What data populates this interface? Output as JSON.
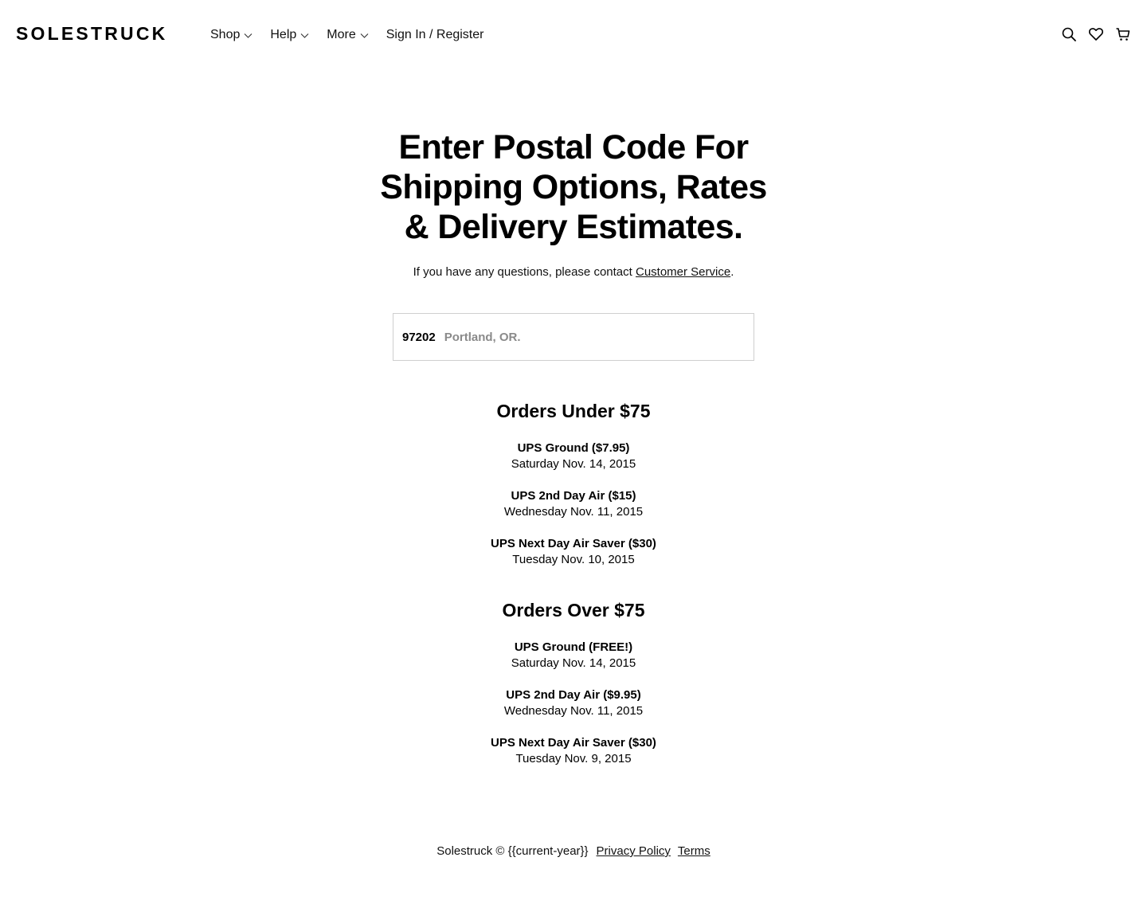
{
  "header": {
    "logo": "SOLESTRUCK",
    "nav": {
      "shop": "Shop",
      "help": "Help",
      "more": "More",
      "signin": "Sign In / Register"
    },
    "icons": [
      "search-icon",
      "heart-icon",
      "cart-icon"
    ]
  },
  "main": {
    "title_line1": "Enter Postal Code For",
    "title_line2": "Shipping Options, Rates",
    "title_line3": "& Delivery Estimates.",
    "subtitle_prefix": "If you have any questions, please contact ",
    "subtitle_link": "Customer Service",
    "subtitle_suffix": ".",
    "postal_code": "97202",
    "postal_city": "Portland, OR.",
    "under": {
      "title": "Orders Under $75",
      "options": [
        {
          "name": "UPS Ground ($7.95)",
          "date": "Saturday Nov. 14, 2015"
        },
        {
          "name": "UPS 2nd Day Air ($15)",
          "date": "Wednesday Nov. 11, 2015"
        },
        {
          "name": "UPS Next Day Air Saver ($30)",
          "date": "Tuesday Nov. 10, 2015"
        }
      ]
    },
    "over": {
      "title": "Orders Over $75",
      "options": [
        {
          "name": "UPS Ground (FREE!)",
          "date": "Saturday Nov. 14, 2015"
        },
        {
          "name": "UPS 2nd Day Air ($9.95)",
          "date": "Wednesday Nov. 11, 2015"
        },
        {
          "name": "UPS Next Day Air Saver ($30)",
          "date": "Tuesday Nov. 9, 2015"
        }
      ]
    }
  },
  "footer": {
    "copyright": "Solestruck © {{current-year}}",
    "privacy": "Privacy Policy",
    "terms": "Terms"
  }
}
